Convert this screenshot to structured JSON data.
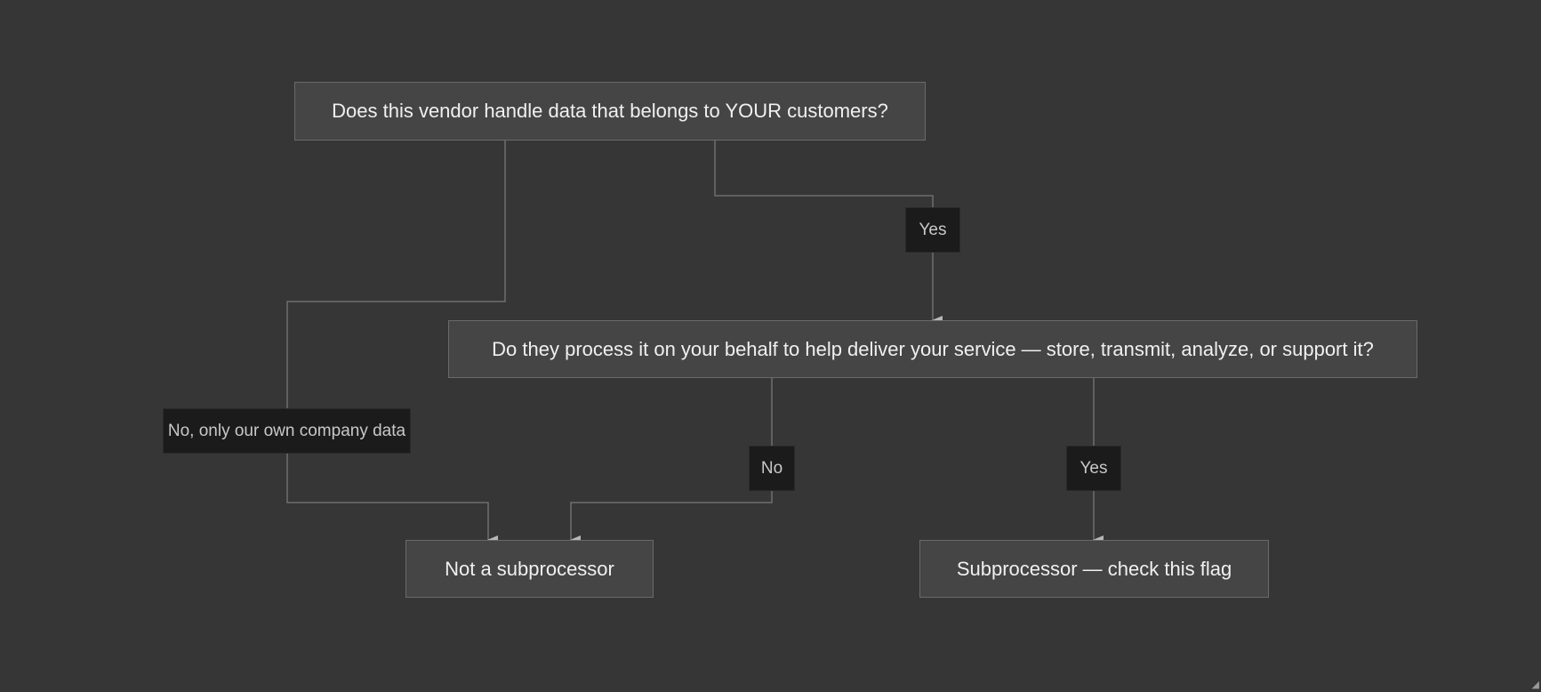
{
  "diagram": {
    "nodes": {
      "q1": "Does this vendor handle data that belongs to YOUR customers?",
      "q2": "Do they process it on your behalf to help deliver your service — store, transmit, analyze, or support it?",
      "not_sub": "Not a subprocessor",
      "sub": "Subprocessor — check this flag"
    },
    "edge_labels": {
      "q1_yes": "Yes",
      "q1_no": "No, only our own company data",
      "q2_no": "No",
      "q2_yes": "Yes"
    },
    "colors": {
      "background": "#363636",
      "node_fill": "#454545",
      "node_border": "#6a6a6a",
      "label_fill": "#1b1b1b",
      "connector": "#6e6e6e",
      "arrowhead": "#b8b8b8"
    }
  }
}
